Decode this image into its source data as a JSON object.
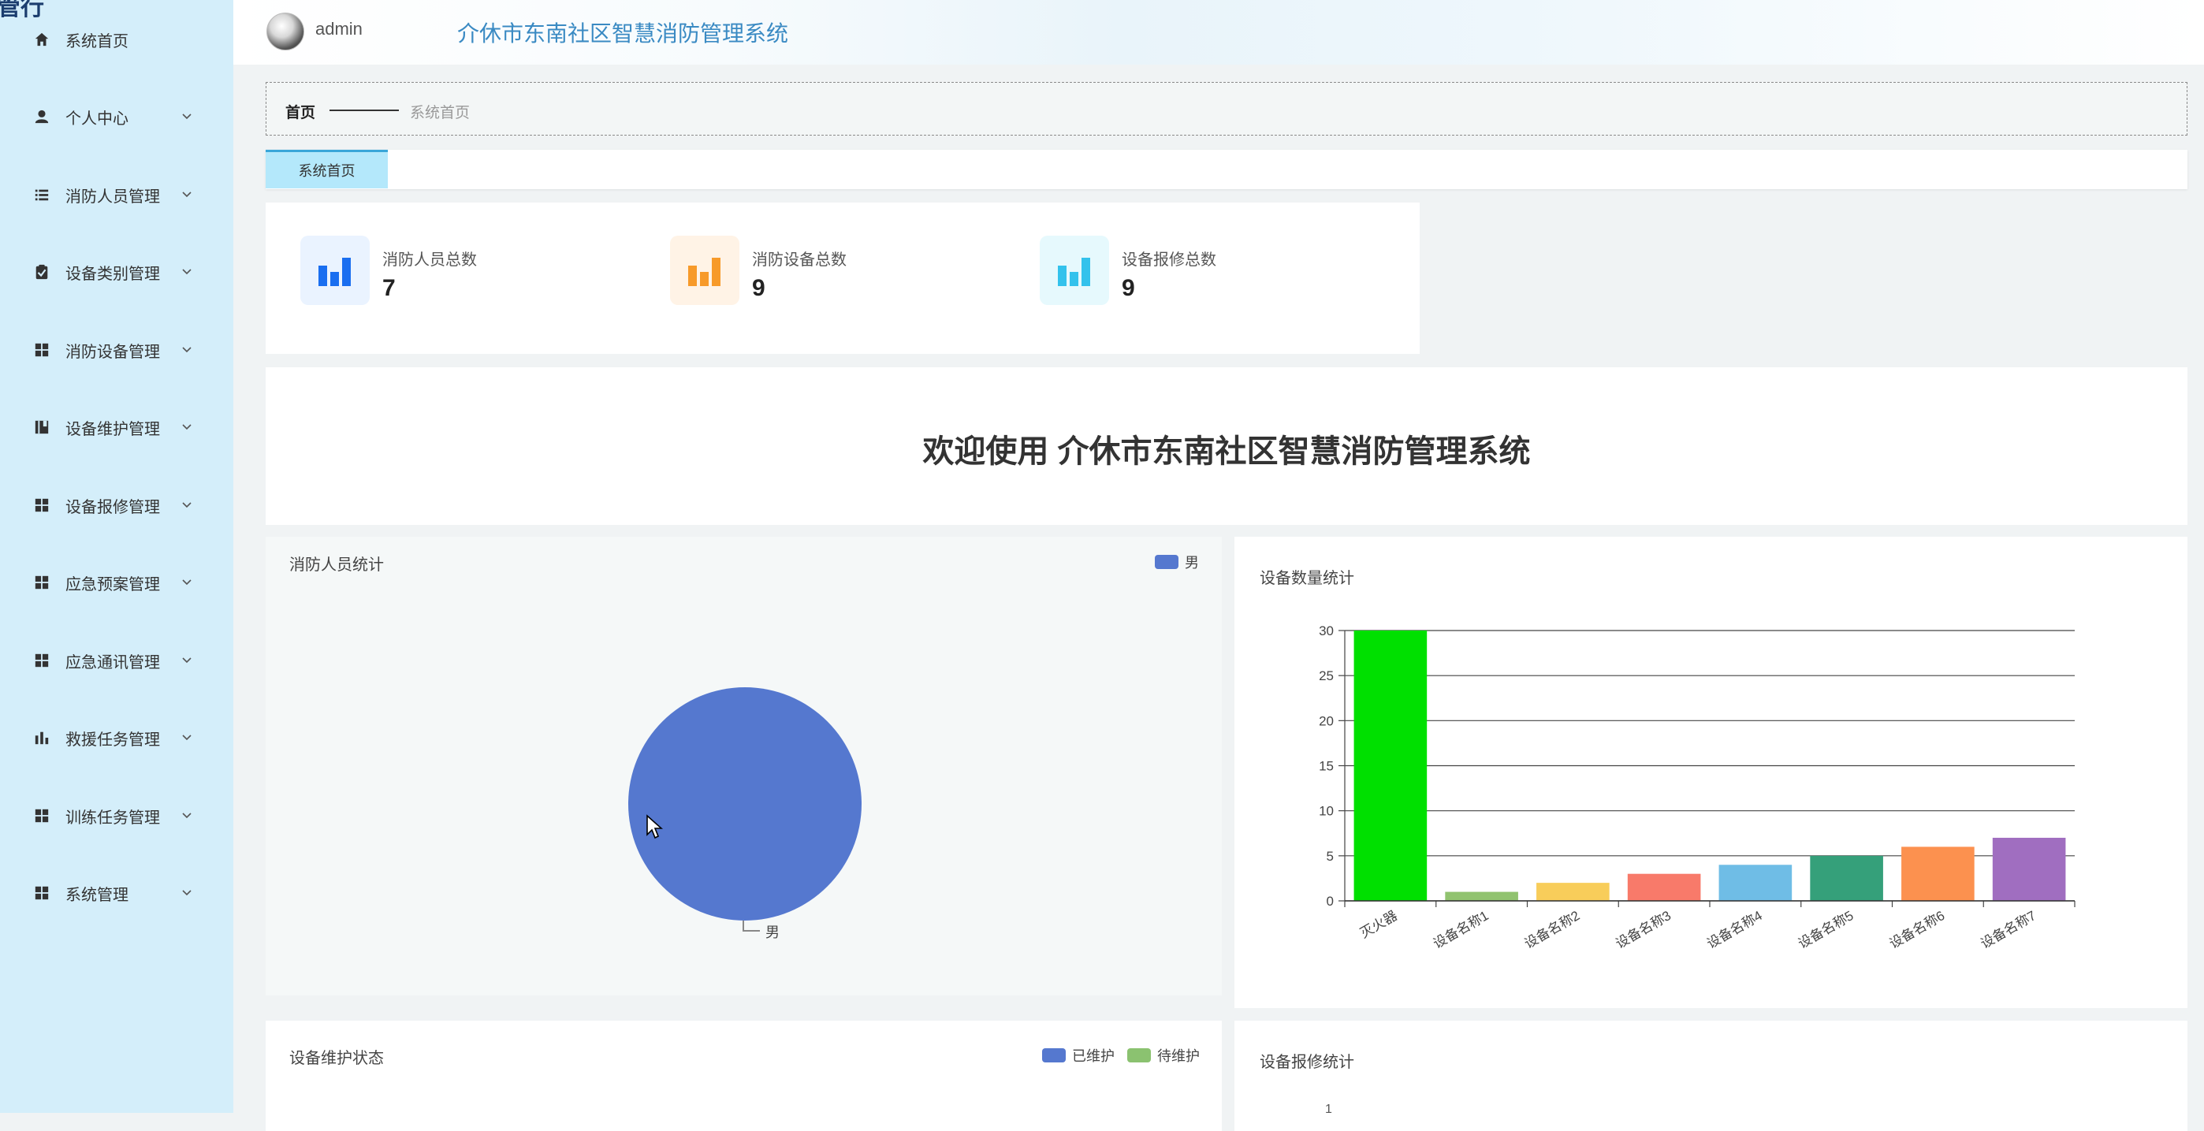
{
  "sidebar": {
    "brand_fragment": "管行",
    "items": [
      {
        "label": "系统首页",
        "icon": "home-icon"
      },
      {
        "label": "个人中心",
        "icon": "user-icon"
      },
      {
        "label": "消防人员管理",
        "icon": "list-icon"
      },
      {
        "label": "设备类别管理",
        "icon": "clipboard-check-icon"
      },
      {
        "label": "消防设备管理",
        "icon": "grid-icon"
      },
      {
        "label": "设备维护管理",
        "icon": "book-icon"
      },
      {
        "label": "设备报修管理",
        "icon": "grid-icon"
      },
      {
        "label": "应急预案管理",
        "icon": "grid-icon"
      },
      {
        "label": "应急通讯管理",
        "icon": "grid-icon"
      },
      {
        "label": "救援任务管理",
        "icon": "bar-chart-icon"
      },
      {
        "label": "训练任务管理",
        "icon": "grid-icon"
      },
      {
        "label": "系统管理",
        "icon": "grid-icon"
      }
    ]
  },
  "header": {
    "username": "admin",
    "title": "介休市东南社区智慧消防管理系统"
  },
  "breadcrumb": {
    "home": "首页",
    "current": "系统首页"
  },
  "tabs": [
    {
      "label": "系统首页",
      "active": true
    }
  ],
  "stats": [
    {
      "label": "消防人员总数",
      "value": "7",
      "icon": "bar-chart-icon",
      "color": "#1a6ef0",
      "bg": "#eaf3ff"
    },
    {
      "label": "消防设备总数",
      "value": "9",
      "icon": "bar-chart-icon",
      "color": "#f79a2a",
      "bg": "#fff3e6"
    },
    {
      "label": "设备报修总数",
      "value": "9",
      "icon": "bar-chart-icon",
      "color": "#33c2ec",
      "bg": "#e6f9fd"
    }
  ],
  "welcome": {
    "title": "欢迎使用 介休市东南社区智慧消防管理系统"
  },
  "panels": {
    "personnel": {
      "title": "消防人员统计",
      "legend": "男",
      "slice_label": "男"
    },
    "equipment": {
      "title": "设备数量统计"
    },
    "maintenance": {
      "title": "设备维护状态",
      "legend": [
        "已维护",
        "待维护"
      ]
    },
    "repair": {
      "title": "设备报修统计",
      "y_tick_top": "1"
    }
  },
  "colors": {
    "pie_blue": "#5578cf",
    "maintained": "#5578cf",
    "pending": "#8bc270"
  },
  "chart_data": [
    {
      "type": "pie",
      "title": "消防人员统计",
      "categories": [
        "男"
      ],
      "values": [
        7
      ],
      "legend": "top-right"
    },
    {
      "type": "bar",
      "title": "设备数量统计",
      "categories": [
        "灭火器",
        "设备名称1",
        "设备名称2",
        "设备名称3",
        "设备名称4",
        "设备名称5",
        "设备名称6",
        "设备名称7"
      ],
      "values": [
        30,
        1,
        2,
        3,
        4,
        5,
        6,
        7
      ],
      "colors": [
        "#00e000",
        "#91c36f",
        "#f8cd5a",
        "#f87a6a",
        "#6fbde6",
        "#35a07a",
        "#fc914f",
        "#a06ec0"
      ],
      "ylim": [
        0,
        30
      ],
      "yticks": [
        0,
        5,
        10,
        15,
        20,
        25,
        30
      ],
      "grid": true
    }
  ]
}
